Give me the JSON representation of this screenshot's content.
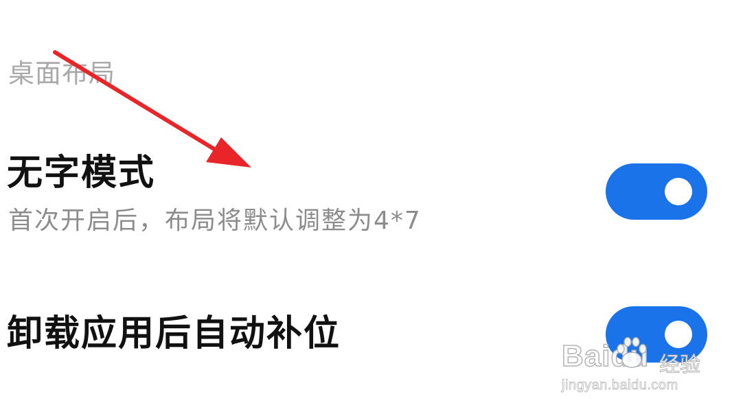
{
  "section": {
    "title": "桌面布局"
  },
  "settings": [
    {
      "title": "无字模式",
      "subtitle": "首次开启后，布局将默认调整为4*7",
      "toggle_on": true
    },
    {
      "title": "卸载应用后自动补位",
      "toggle_on": true
    }
  ],
  "colors": {
    "toggle_on": "#1a73e8",
    "arrow": "#e8262a",
    "title": "#111111",
    "subtitle": "#8c8c8c",
    "section_title": "#a9a9a9"
  },
  "watermark": {
    "logo": "Baidu",
    "logo_cn": "经验",
    "url": "jingyan.baidu.com",
    "icon": "paw-icon"
  },
  "annotation": {
    "icon": "arrow-icon"
  }
}
